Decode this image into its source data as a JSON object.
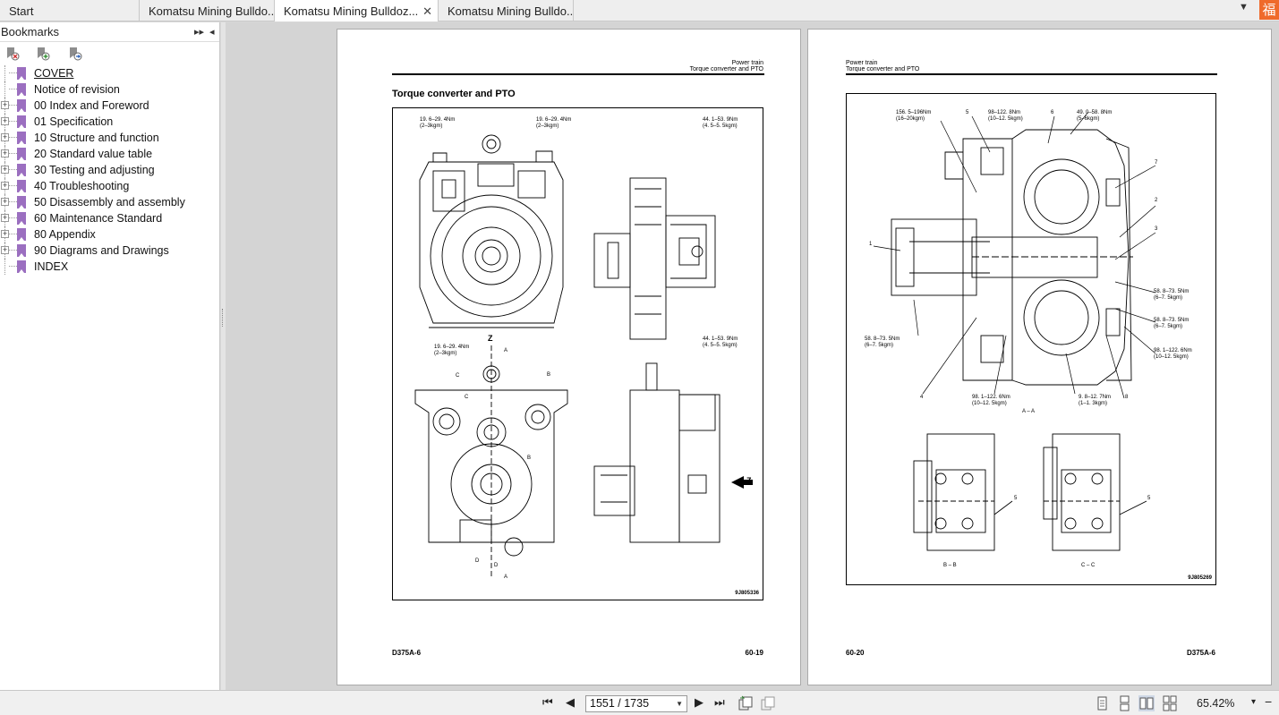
{
  "tabs": [
    {
      "label": "Start"
    },
    {
      "label": "Komatsu Mining Bulldo..."
    },
    {
      "label": "Komatsu Mining Bulldoz...",
      "close": "✕"
    },
    {
      "label": "Komatsu Mining Bulldo..."
    }
  ],
  "tabbar": {
    "dropdown_glyph": "▼",
    "brand_glyph": "福"
  },
  "bookmarks": {
    "title": "Bookmarks",
    "expand_glyph": "▸▸",
    "collapse_glyph": "◂",
    "toolbar_icons": [
      "bookmark-delete-icon",
      "bookmark-add-icon",
      "bookmark-goto-icon"
    ],
    "items": [
      {
        "label": "COVER",
        "expandable": false,
        "current": true
      },
      {
        "label": "Notice of revision",
        "expandable": false
      },
      {
        "label": "00 Index and Foreword",
        "expandable": true
      },
      {
        "label": "01 Specification",
        "expandable": true
      },
      {
        "label": "10 Structure and function",
        "expandable": true
      },
      {
        "label": "20 Standard value table",
        "expandable": true
      },
      {
        "label": "30 Testing and adjusting",
        "expandable": true
      },
      {
        "label": "40 Troubleshooting",
        "expandable": true
      },
      {
        "label": "50 Disassembly and assembly",
        "expandable": true
      },
      {
        "label": "60 Maintenance Standard",
        "expandable": true
      },
      {
        "label": "80 Appendix",
        "expandable": true
      },
      {
        "label": "90 Diagrams and Drawings",
        "expandable": true
      },
      {
        "label": "INDEX",
        "expandable": false
      }
    ]
  },
  "left_page": {
    "header_line1": "Power train",
    "header_line2": "Torque converter and PTO",
    "title": "Torque converter and PTO",
    "figure_id": "9J805336",
    "footer_left": "D375A-6",
    "footer_right": "60-19",
    "callouts": {
      "c1": "19. 6–29. 4Nm",
      "c1b": "(2–3kgm)",
      "c2": "19. 6–29. 4Nm",
      "c2b": "(2–3kgm)",
      "c3": "44. 1–53. 9Nm",
      "c3b": "(4. 5–5. 5kgm)",
      "c4": "44. 1–53. 9Nm",
      "c4b": "(4. 5–5. 5kgm)",
      "c5": "19. 6–29. 4Nm",
      "c5b": "(2–3kgm)",
      "z_top": "Z",
      "z_side": "Z",
      "a_top": "A",
      "a_bot": "A",
      "b_label": "B",
      "b_label2": "B",
      "c_label": "C",
      "c_label2": "C",
      "d_label": "D",
      "d_label2": "D"
    }
  },
  "right_page": {
    "header_line1": "Power train",
    "header_line2": "Torque converter and PTO",
    "figure_id": "9J805269",
    "footer_left": "60-20",
    "footer_right": "D375A-6",
    "callouts": {
      "t1": "156. 5–196Nm",
      "t1b": "(16–20kgm)",
      "t2": "98–122. 8Nm",
      "t2b": "(10–12. 5kgm)",
      "t3": "49. 0–58. 8Nm",
      "t3b": "(5–6kgm)",
      "t4": "58. 8–73. 5Nm",
      "t4b": "(6–7. 5kgm)",
      "t5": "58. 8–73. 5Nm",
      "t5b": "(6–7. 5kgm)",
      "t6": "98. 1–122. 6Nm",
      "t6b": "(10–12. 5kgm)",
      "t7": "58. 8–73. 5Nm",
      "t7b": "(6–7. 5kgm)",
      "t8": "98. 1–122. 6Nm",
      "t8b": "(10–12. 5kgm)",
      "t9": "9. 8–12. 7Nm",
      "t9b": "(1–1. 3kgm)",
      "n5a": "5",
      "n6": "6",
      "n7": "7",
      "n2": "2",
      "n3": "3",
      "n1": "1",
      "n4": "4",
      "n8": "8",
      "n5b": "5",
      "n5c": "5",
      "sec_aa": "A – A",
      "sec_bb": "B – B",
      "sec_cc": "C – C"
    }
  },
  "statusbar": {
    "first_glyph": "⏮",
    "prev_glyph": "◀",
    "page_field": "1551 / 1735",
    "page_arrow": "▼",
    "next_glyph": "▶",
    "last_glyph": "⏭",
    "zoom": "65.42%",
    "zoom_menu": "▾",
    "zoom_minus": "−"
  }
}
